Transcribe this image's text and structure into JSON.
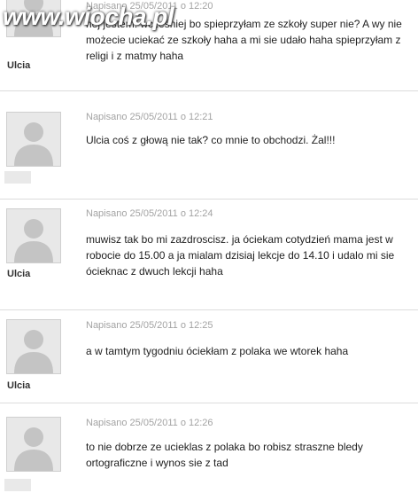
{
  "watermark": "www.wiocha.pl",
  "posts": [
    {
      "date": "Napisano 25/05/2011 o 12:20",
      "text_visible": "hej jestem. wcześniej bo spieprzyłam ze szkoły super nie? A wy nie możecie uciekać ze szkoły haha a mi sie udało haha spieprzyłam z religi i z matmy haha",
      "author": "Ulcia"
    },
    {
      "date": "Napisano 25/05/2011 o 12:21",
      "text_visible": "Ulcia coś z głową nie tak? co mnie to obchodzi. Żal!!!",
      "author": ""
    },
    {
      "date": "Napisano 25/05/2011 o 12:24",
      "text_visible": "muwisz tak bo mi zazdroscisz. ja óciekam cotydzień mama jest w robocie do 15.00 a ja mialam dzisiaj lekcje do 14.10 i udalo mi sie ócieknac z dwuch lekcji haha",
      "author": "Ulcia"
    },
    {
      "date": "Napisano 25/05/2011 o 12:25",
      "text_visible": "a w tamtym tygodniu óciekłam z polaka we wtorek haha",
      "author": "Ulcia"
    },
    {
      "date": "Napisano 25/05/2011 o 12:26",
      "text_visible": "to nie dobrze ze ucieklas z polaka bo robisz straszne bledy ortograficzne i wynos sie z tad",
      "author": ""
    }
  ]
}
